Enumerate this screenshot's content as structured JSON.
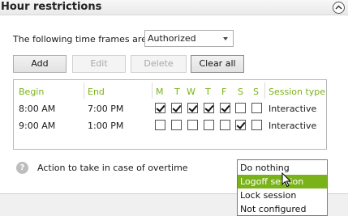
{
  "panel": {
    "title": "Hour restrictions",
    "collapse_icon": "chevron-up-icon"
  },
  "time_frames": {
    "label": "The following time frames are",
    "selected": "Authorized"
  },
  "buttons": {
    "add": "Add",
    "edit": "Edit",
    "delete": "Delete",
    "clear_all": "Clear all"
  },
  "grid": {
    "headers": {
      "begin": "Begin",
      "end": "End",
      "days": [
        "M",
        "T",
        "W",
        "T",
        "F",
        "S",
        "S"
      ],
      "session_type": "Session type"
    },
    "rows": [
      {
        "begin": "8:00 AM",
        "end": "7:00 PM",
        "days": [
          true,
          true,
          true,
          true,
          true,
          false,
          false
        ],
        "session_type": "Interactive"
      },
      {
        "begin": "9:00 AM",
        "end": "1:00 PM",
        "days": [
          false,
          false,
          false,
          false,
          false,
          true,
          false
        ],
        "session_type": "Interactive"
      }
    ]
  },
  "overtime": {
    "help_icon": "help-icon",
    "label": "Action to take in case of overtime",
    "options": [
      "Do nothing",
      "Logoff session",
      "Lock session",
      "Not configured"
    ],
    "highlighted": "Logoff session"
  },
  "colors": {
    "accent": "#7ab319"
  }
}
